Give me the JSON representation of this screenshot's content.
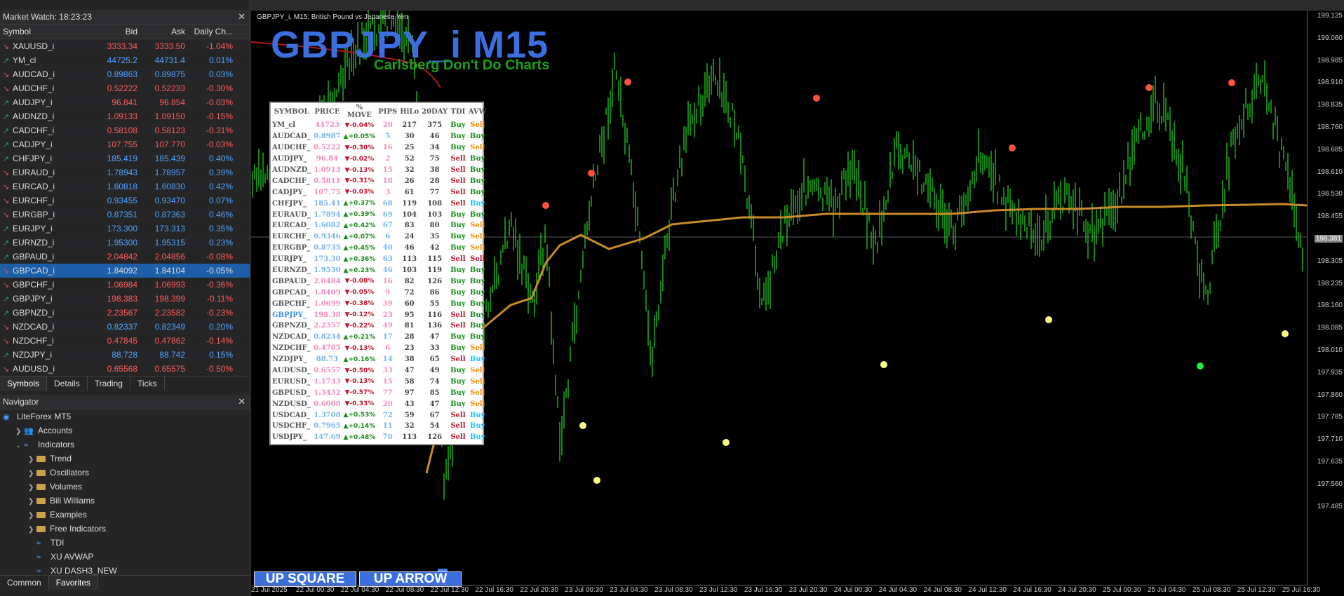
{
  "market_watch": {
    "title": "Market Watch: 18:23:23",
    "columns": [
      "Symbol",
      "Bid",
      "Ask",
      "Daily Ch..."
    ],
    "rows": [
      {
        "symbol": "XAUUSD_i",
        "bid": "3333.34",
        "ask": "3333.50",
        "chg": "-1.04%",
        "dir": "dn"
      },
      {
        "symbol": "YM_cl",
        "bid": "44725.2",
        "ask": "44731.4",
        "chg": "0.01%",
        "dir": "up"
      },
      {
        "symbol": "AUDCAD_i",
        "bid": "0.89863",
        "ask": "0.89875",
        "chg": "0.03%",
        "dir": "dn"
      },
      {
        "symbol": "AUDCHF_i",
        "bid": "0.52222",
        "ask": "0.52233",
        "chg": "-0.30%",
        "dir": "dn"
      },
      {
        "symbol": "AUDJPY_i",
        "bid": "96.841",
        "ask": "96.854",
        "chg": "-0.03%",
        "dir": "up"
      },
      {
        "symbol": "AUDNZD_i",
        "bid": "1.09133",
        "ask": "1.09150",
        "chg": "-0.15%",
        "dir": "up"
      },
      {
        "symbol": "CADCHF_i",
        "bid": "0.58108",
        "ask": "0.58123",
        "chg": "-0.31%",
        "dir": "up"
      },
      {
        "symbol": "CADJPY_i",
        "bid": "107.755",
        "ask": "107.770",
        "chg": "-0.03%",
        "dir": "up"
      },
      {
        "symbol": "CHFJPY_i",
        "bid": "185.419",
        "ask": "185.439",
        "chg": "0.40%",
        "dir": "up"
      },
      {
        "symbol": "EURAUD_i",
        "bid": "1.78943",
        "ask": "1.78957",
        "chg": "0.39%",
        "dir": "dn"
      },
      {
        "symbol": "EURCAD_i",
        "bid": "1.60818",
        "ask": "1.60830",
        "chg": "0.42%",
        "dir": "dn"
      },
      {
        "symbol": "EURCHF_i",
        "bid": "0.93455",
        "ask": "0.93470",
        "chg": "0.07%",
        "dir": "dn"
      },
      {
        "symbol": "EURGBP_i",
        "bid": "0.87351",
        "ask": "0.87363",
        "chg": "0.46%",
        "dir": "dn"
      },
      {
        "symbol": "EURJPY_i",
        "bid": "173.300",
        "ask": "173.313",
        "chg": "0.35%",
        "dir": "up"
      },
      {
        "symbol": "EURNZD_i",
        "bid": "1.95300",
        "ask": "1.95315",
        "chg": "0.23%",
        "dir": "up"
      },
      {
        "symbol": "GBPAUD_i",
        "bid": "2.04842",
        "ask": "2.04856",
        "chg": "-0.08%",
        "dir": "up"
      },
      {
        "symbol": "GBPCAD_i",
        "bid": "1.84092",
        "ask": "1.84104",
        "chg": "-0.05%",
        "dir": "dn",
        "selected": true
      },
      {
        "symbol": "GBPCHF_i",
        "bid": "1.06984",
        "ask": "1.06993",
        "chg": "-0.36%",
        "dir": "dn"
      },
      {
        "symbol": "GBPJPY_i",
        "bid": "198.383",
        "ask": "198.399",
        "chg": "-0.11%",
        "dir": "up"
      },
      {
        "symbol": "GBPNZD_i",
        "bid": "2.23567",
        "ask": "2.23582",
        "chg": "-0.23%",
        "dir": "up"
      },
      {
        "symbol": "NZDCAD_i",
        "bid": "0.82337",
        "ask": "0.82349",
        "chg": "0.20%",
        "dir": "dn"
      },
      {
        "symbol": "NZDCHF_i",
        "bid": "0.47845",
        "ask": "0.47862",
        "chg": "-0.14%",
        "dir": "dn"
      },
      {
        "symbol": "NZDJPY_i",
        "bid": "88.728",
        "ask": "88.742",
        "chg": "0.15%",
        "dir": "up"
      },
      {
        "symbol": "AUDUSD_i",
        "bid": "0.65568",
        "ask": "0.65575",
        "chg": "-0.50%",
        "dir": "dn"
      }
    ],
    "tabs": [
      "Symbols",
      "Details",
      "Trading",
      "Ticks"
    ]
  },
  "navigator": {
    "title": "Navigator",
    "items": [
      {
        "label": "LiteForex MT5",
        "level": 0,
        "kind": "root"
      },
      {
        "label": "Accounts",
        "level": 1,
        "kind": "accounts",
        "chev": ">"
      },
      {
        "label": "Indicators",
        "level": 1,
        "kind": "indicators",
        "chev": "v"
      },
      {
        "label": "Trend",
        "level": 2,
        "kind": "folder",
        "chev": ">"
      },
      {
        "label": "Oscillators",
        "level": 2,
        "kind": "folder",
        "chev": ">"
      },
      {
        "label": "Volumes",
        "level": 2,
        "kind": "folder",
        "chev": ">"
      },
      {
        "label": "Bill Williams",
        "level": 2,
        "kind": "folder",
        "chev": ">"
      },
      {
        "label": "Examples",
        "level": 2,
        "kind": "folder",
        "chev": ">"
      },
      {
        "label": "Free Indicators",
        "level": 2,
        "kind": "folder",
        "chev": ">"
      },
      {
        "label": "TDI",
        "level": 2,
        "kind": "ind"
      },
      {
        "label": "XU AVWAP",
        "level": 2,
        "kind": "ind"
      },
      {
        "label": "XU DASH3_NEW",
        "level": 2,
        "kind": "ind"
      }
    ],
    "tabs": [
      "Common",
      "Favorites"
    ]
  },
  "chart": {
    "symbol_label": "GBPJPY_i, M15:  British Pound vs Japanese Yen",
    "big_title": "GBPJPY_i M15",
    "sub_title": "Carlsberg Don't Do Charts",
    "current_price": "198.381",
    "price_labels": [
      "199.125",
      "199.060",
      "198.985",
      "198.910",
      "198.835",
      "198.760",
      "198.685",
      "198.610",
      "198.530",
      "198.455",
      "198.381",
      "198.305",
      "198.235",
      "198.160",
      "198.085",
      "198.010",
      "197.935",
      "197.860",
      "197.785",
      "197.710",
      "197.635",
      "197.560",
      "197.485"
    ],
    "time_labels": [
      "21 Jul 2025",
      "22 Jul 00:30",
      "22 Jul 04:30",
      "22 Jul 08:30",
      "22 Jul 12:30",
      "22 Jul 16:30",
      "22 Jul 20:30",
      "23 Jul 00:30",
      "23 Jul 04:30",
      "23 Jul 08:30",
      "23 Jul 12:30",
      "23 Jul 16:30",
      "23 Jul 20:30",
      "24 Jul 00:30",
      "24 Jul 04:30",
      "24 Jul 08:30",
      "24 Jul 12:30",
      "24 Jul 16:30",
      "24 Jul 20:30",
      "25 Jul 00:30",
      "25 Jul 04:30",
      "25 Jul 08:30",
      "25 Jul 12:30",
      "25 Jul 16:30"
    ],
    "buttons": {
      "up_square": "UP SQUARE",
      "up_arrow": "UP ARROW"
    },
    "colors": {
      "candle": "#22dd22",
      "ma": "#c98b2b",
      "title": "#3b6fe0",
      "subtitle": "#1aa01a",
      "top_dot": "#ff5040",
      "bottom_dot": "#ffff88"
    }
  },
  "dashboard": {
    "headers": [
      "SYMBOL",
      "PRICE",
      "% MOVE",
      "PIPS",
      "HiLo",
      "20DAY",
      "TDI",
      "AVW"
    ],
    "rows": [
      [
        "YM_cl",
        "44723",
        "-0.04%",
        "20",
        "217",
        "375",
        "Buy",
        "Sell"
      ],
      [
        "AUDCAD_",
        "0.8987",
        "+0.05%",
        "5",
        "30",
        "46",
        "Buy",
        "Buy"
      ],
      [
        "AUDCHF_",
        "0.5222",
        "-0.30%",
        "16",
        "25",
        "34",
        "Buy",
        "Sell"
      ],
      [
        "AUDJPY_",
        "96.84",
        "-0.02%",
        "2",
        "52",
        "75",
        "Sell",
        "Buy"
      ],
      [
        "AUDNZD_",
        "1.0913",
        "-0.13%",
        "15",
        "32",
        "38",
        "Sell",
        "Buy"
      ],
      [
        "CADCHF_",
        "0.5811",
        "-0.31%",
        "18",
        "26",
        "28",
        "Sell",
        "Buy"
      ],
      [
        "CADJPY_",
        "107.75",
        "-0.03%",
        "3",
        "61",
        "77",
        "Sell",
        "Buy"
      ],
      [
        "CHFJPY_",
        "185.41",
        "+0.37%",
        "68",
        "119",
        "108",
        "Sell",
        "Buy"
      ],
      [
        "EURAUD_",
        "1.7894",
        "+0.39%",
        "69",
        "104",
        "103",
        "Buy",
        "Buy"
      ],
      [
        "EURCAD_",
        "1.6082",
        "+0.42%",
        "67",
        "83",
        "80",
        "Buy",
        "Sell"
      ],
      [
        "EURCHF_",
        "0.9346",
        "+0.07%",
        "6",
        "24",
        "35",
        "Buy",
        "Sell"
      ],
      [
        "EURGBP_",
        "0.8735",
        "+0.45%",
        "40",
        "46",
        "42",
        "Buy",
        "Sell"
      ],
      [
        "EURJPY_",
        "173.30",
        "+0.36%",
        "63",
        "113",
        "115",
        "Sell",
        "Sell"
      ],
      [
        "EURNZD_",
        "1.9530",
        "+0.23%",
        "46",
        "103",
        "119",
        "Buy",
        "Buy"
      ],
      [
        "GBPAUD_",
        "2.0484",
        "-0.08%",
        "16",
        "82",
        "126",
        "Buy",
        "Buy"
      ],
      [
        "GBPCAD_",
        "1.8409",
        "-0.05%",
        "9",
        "72",
        "86",
        "Buy",
        "Buy"
      ],
      [
        "GBPCHF_",
        "1.0699",
        "-0.38%",
        "39",
        "60",
        "55",
        "Buy",
        "Buy"
      ],
      [
        "GBPJPY_",
        "198.38",
        "-0.12%",
        "23",
        "95",
        "116",
        "Sell",
        "Buy"
      ],
      [
        "GBPNZD_",
        "2.2357",
        "-0.22%",
        "49",
        "81",
        "136",
        "Sell",
        "Buy"
      ],
      [
        "NZDCAD_",
        "0.8234",
        "+0.21%",
        "17",
        "28",
        "47",
        "Buy",
        "Buy"
      ],
      [
        "NZDCHF_",
        "0.4785",
        "-0.13%",
        "6",
        "23",
        "33",
        "Buy",
        "Sell"
      ],
      [
        "NZDJPY_",
        "88.73",
        "+0.16%",
        "14",
        "38",
        "65",
        "Sell",
        "Buy"
      ],
      [
        "AUDUSD_",
        "0.6557",
        "-0.50%",
        "33",
        "47",
        "49",
        "Buy",
        "Sell"
      ],
      [
        "EURUSD_",
        "1.1733",
        "-0.13%",
        "15",
        "58",
        "74",
        "Buy",
        "Sell"
      ],
      [
        "GBPUSD_",
        "1.3432",
        "-0.57%",
        "77",
        "97",
        "85",
        "Buy",
        "Sell"
      ],
      [
        "NZDUSD_",
        "0.6008",
        "-0.33%",
        "20",
        "43",
        "47",
        "Buy",
        "Sell"
      ],
      [
        "USDCAD_",
        "1.3708",
        "+0.53%",
        "72",
        "59",
        "67",
        "Sell",
        "Buy"
      ],
      [
        "USDCHF_",
        "0.7965",
        "+0.14%",
        "11",
        "32",
        "54",
        "Sell",
        "Buy"
      ],
      [
        "USDJPY_",
        "147.69",
        "+0.48%",
        "70",
        "113",
        "126",
        "Sell",
        "Buy"
      ]
    ]
  }
}
